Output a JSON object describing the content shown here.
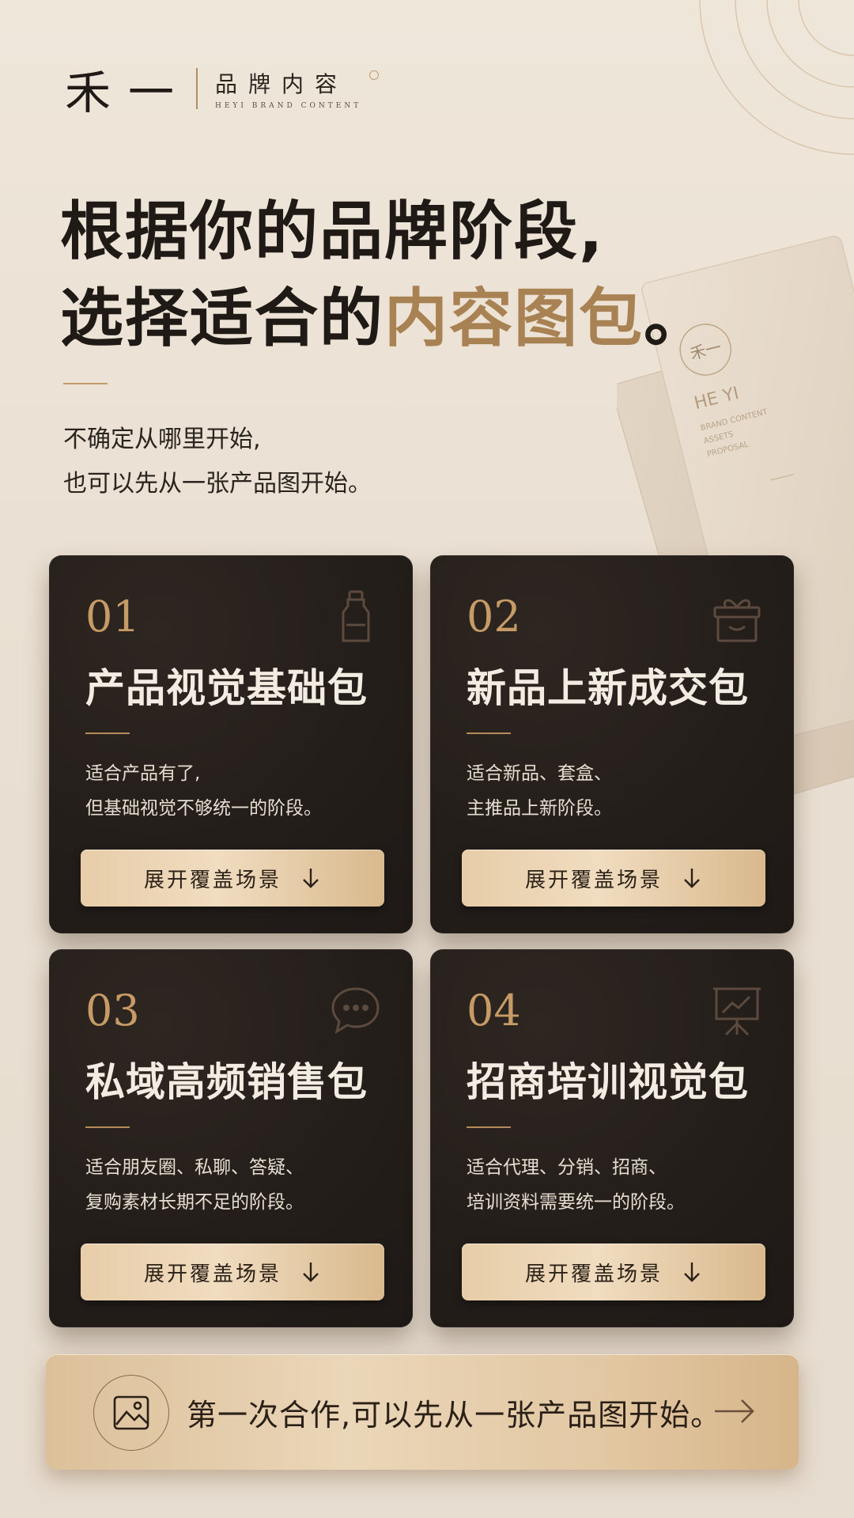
{
  "brand": {
    "logo": "禾一",
    "name_cn": "品牌内容",
    "name_en": "HEYI BRAND CONTENT"
  },
  "headline": {
    "line1": "根据你的品牌阶段,",
    "line2_prefix": "选择适合的",
    "line2_accent": "内容图包",
    "line2_suffix": "。"
  },
  "subtext": {
    "line1": "不确定从哪里开始,",
    "line2": "也可以先从一张产品图开始。"
  },
  "decor": {
    "card_logo": "禾一",
    "card_name": "HE YI",
    "card_lines": [
      "BRAND CONTENT",
      "ASSETS",
      "PROPOSAL"
    ]
  },
  "packages": [
    {
      "number": "01",
      "title": "产品视觉基础包",
      "desc_line1": "适合产品有了,",
      "desc_line2": "但基础视觉不够统一的阶段。",
      "button": "展开覆盖场景",
      "icon": "bottle-icon"
    },
    {
      "number": "02",
      "title": "新品上新成交包",
      "desc_line1": "适合新品、套盒、",
      "desc_line2": "主推品上新阶段。",
      "button": "展开覆盖场景",
      "icon": "gift-box-icon"
    },
    {
      "number": "03",
      "title": "私域高频销售包",
      "desc_line1": "适合朋友圈、私聊、答疑、",
      "desc_line2": "复购素材长期不足的阶段。",
      "button": "展开覆盖场景",
      "icon": "chat-bubble-icon"
    },
    {
      "number": "04",
      "title": "招商培训视觉包",
      "desc_line1": "适合代理、分销、招商、",
      "desc_line2": "培训资料需要统一的阶段。",
      "button": "展开覆盖场景",
      "icon": "presentation-chart-icon"
    }
  ],
  "cta": {
    "text": "第一次合作,可以先从一张产品图开始。",
    "icon": "image-icon",
    "arrow": "arrow-right-icon"
  },
  "colors": {
    "accent": "#a98254",
    "card_bg": "#241e1a",
    "gold_button": "#ead6b8"
  }
}
